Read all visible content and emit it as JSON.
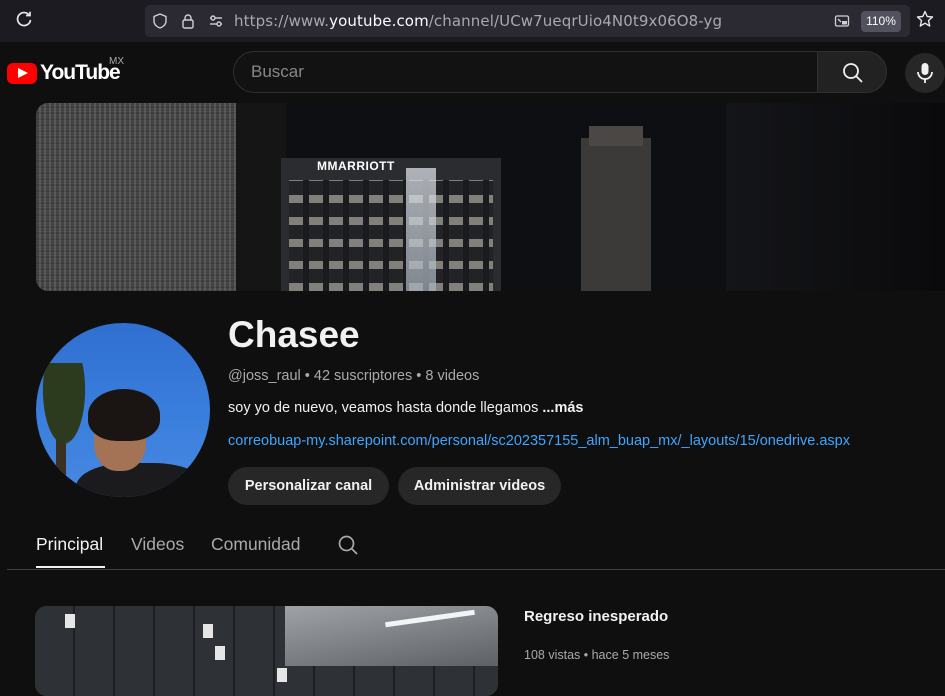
{
  "browser": {
    "url_prefix": "https://www.",
    "url_domain": "youtube.com",
    "url_path": "/channel/UCw7ueqrUio4N0t9x06O8-yg",
    "zoom": "110%"
  },
  "header": {
    "logo_text": "YouTube",
    "region": "MX",
    "search_placeholder": "Buscar"
  },
  "banner": {
    "sign_letter": "M",
    "sign_text": "MARRIOTT"
  },
  "channel": {
    "name": "Chasee",
    "handle": "@joss_raul",
    "subscribers": "42 suscriptores",
    "videos": "8 videos",
    "separator": " • ",
    "description": "soy yo de nuevo, veamos hasta donde llegamos ",
    "more": "...más",
    "link": "correobuap-my.sharepoint.com/personal/sc202357155_alm_buap_mx/_layouts/15/onedrive.aspx",
    "customize_button": "Personalizar canal",
    "manage_button": "Administrar videos"
  },
  "tabs": [
    {
      "label": "Principal",
      "active": true
    },
    {
      "label": "Videos",
      "active": false
    },
    {
      "label": "Comunidad",
      "active": false
    }
  ],
  "featured_video": {
    "title": "Regreso inesperado",
    "views": "108 vistas",
    "age": "hace 5 meses",
    "separator": " • "
  },
  "colors": {
    "background": "#0f0f0f",
    "brand_red": "#ff0000",
    "link_blue": "#3ea6ff"
  }
}
